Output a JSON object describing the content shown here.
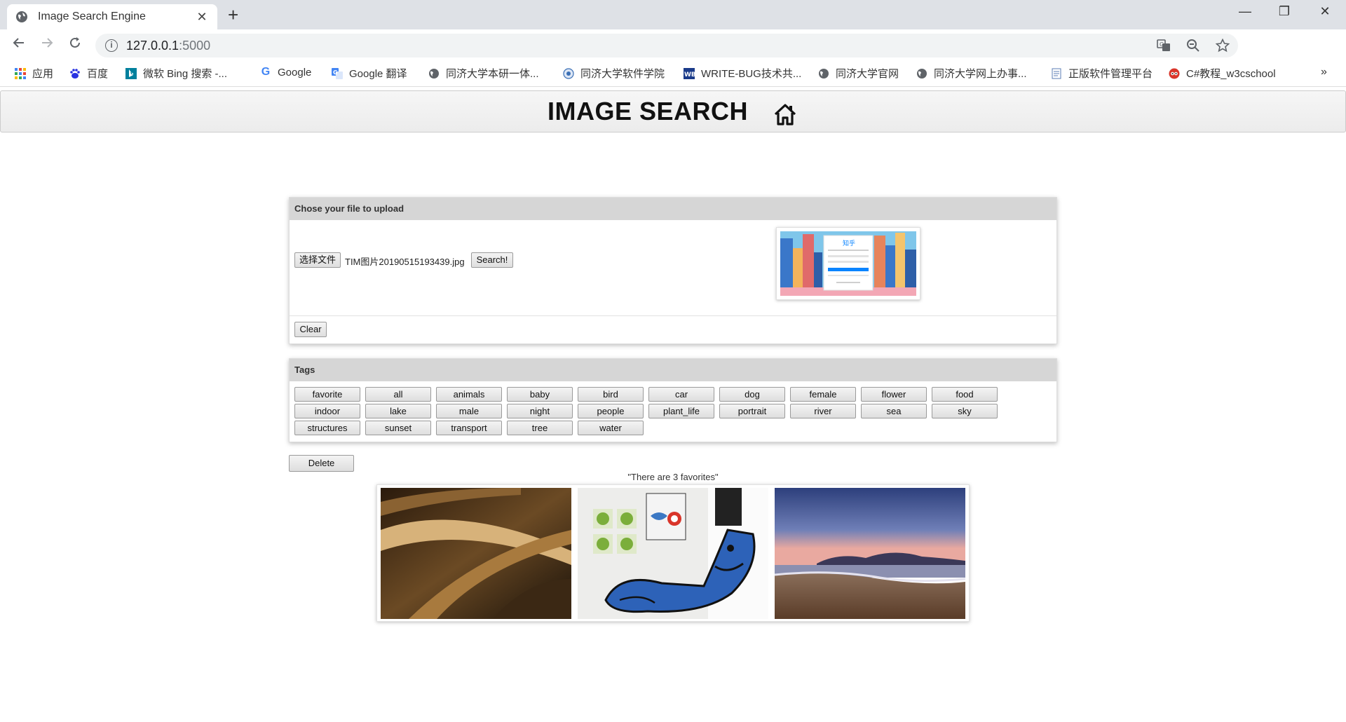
{
  "browser": {
    "tab_title": "Image Search Engine",
    "tab_close": "✕",
    "new_tab": "+",
    "window_controls": [
      "—",
      "❐",
      "✕"
    ],
    "url_host": "127.0.0.1",
    "url_port": ":5000",
    "bookmarks": [
      {
        "label": "应用",
        "icon": "apps-grid-icon",
        "color": "#4285f4"
      },
      {
        "label": "百度",
        "icon": "baidu-paw-icon",
        "color": "#2932e1"
      },
      {
        "label": "微软 Bing 搜索 -...",
        "icon": "bing-icon",
        "color": "#00809d"
      },
      {
        "label": "Google",
        "icon": "google-g-icon",
        "color": "#4285f4"
      },
      {
        "label": "Google 翻译",
        "icon": "google-translate-icon",
        "color": "#4285f4"
      },
      {
        "label": "同济大学本研一体...",
        "icon": "globe-icon",
        "color": "#5f6368"
      },
      {
        "label": "同济大学软件学院",
        "icon": "tongji-logo-icon",
        "color": "#3a6fb5"
      },
      {
        "label": "WRITE-BUG技术共...",
        "icon": "writebug-icon",
        "color": "#1a3b8a"
      },
      {
        "label": "同济大学官网",
        "icon": "globe-icon",
        "color": "#5f6368"
      },
      {
        "label": "同济大学网上办事...",
        "icon": "globe-icon",
        "color": "#5f6368"
      },
      {
        "label": "正版软件管理平台",
        "icon": "document-icon",
        "color": "#5b7db5"
      },
      {
        "label": "C#教程_w3cschool",
        "icon": "w3cschool-owl-icon",
        "color": "#d9352a"
      }
    ],
    "more": "»"
  },
  "page": {
    "title": "IMAGE SEARCH",
    "home_icon": "home-icon",
    "upload": {
      "heading": "Chose your file to upload",
      "choose_label": "选择文件",
      "file_name": "TIM图片20190515193439.jpg",
      "search_label": "Search!",
      "preview_brand": "知乎",
      "clear_label": "Clear"
    },
    "tags": {
      "heading": "Tags",
      "items": [
        "favorite",
        "all",
        "animals",
        "baby",
        "bird",
        "car",
        "dog",
        "female",
        "flower",
        "food",
        "indoor",
        "lake",
        "male",
        "night",
        "people",
        "plant_life",
        "portrait",
        "river",
        "sea",
        "sky",
        "structures",
        "sunset",
        "transport",
        "tree",
        "water"
      ]
    },
    "delete_label": "Delete",
    "favorites_text": "\"There are 3 favorites\"",
    "photos": [
      "abstract-gold-curves-photo",
      "street-art-blue-character-photo",
      "beach-sunset-photo"
    ]
  }
}
